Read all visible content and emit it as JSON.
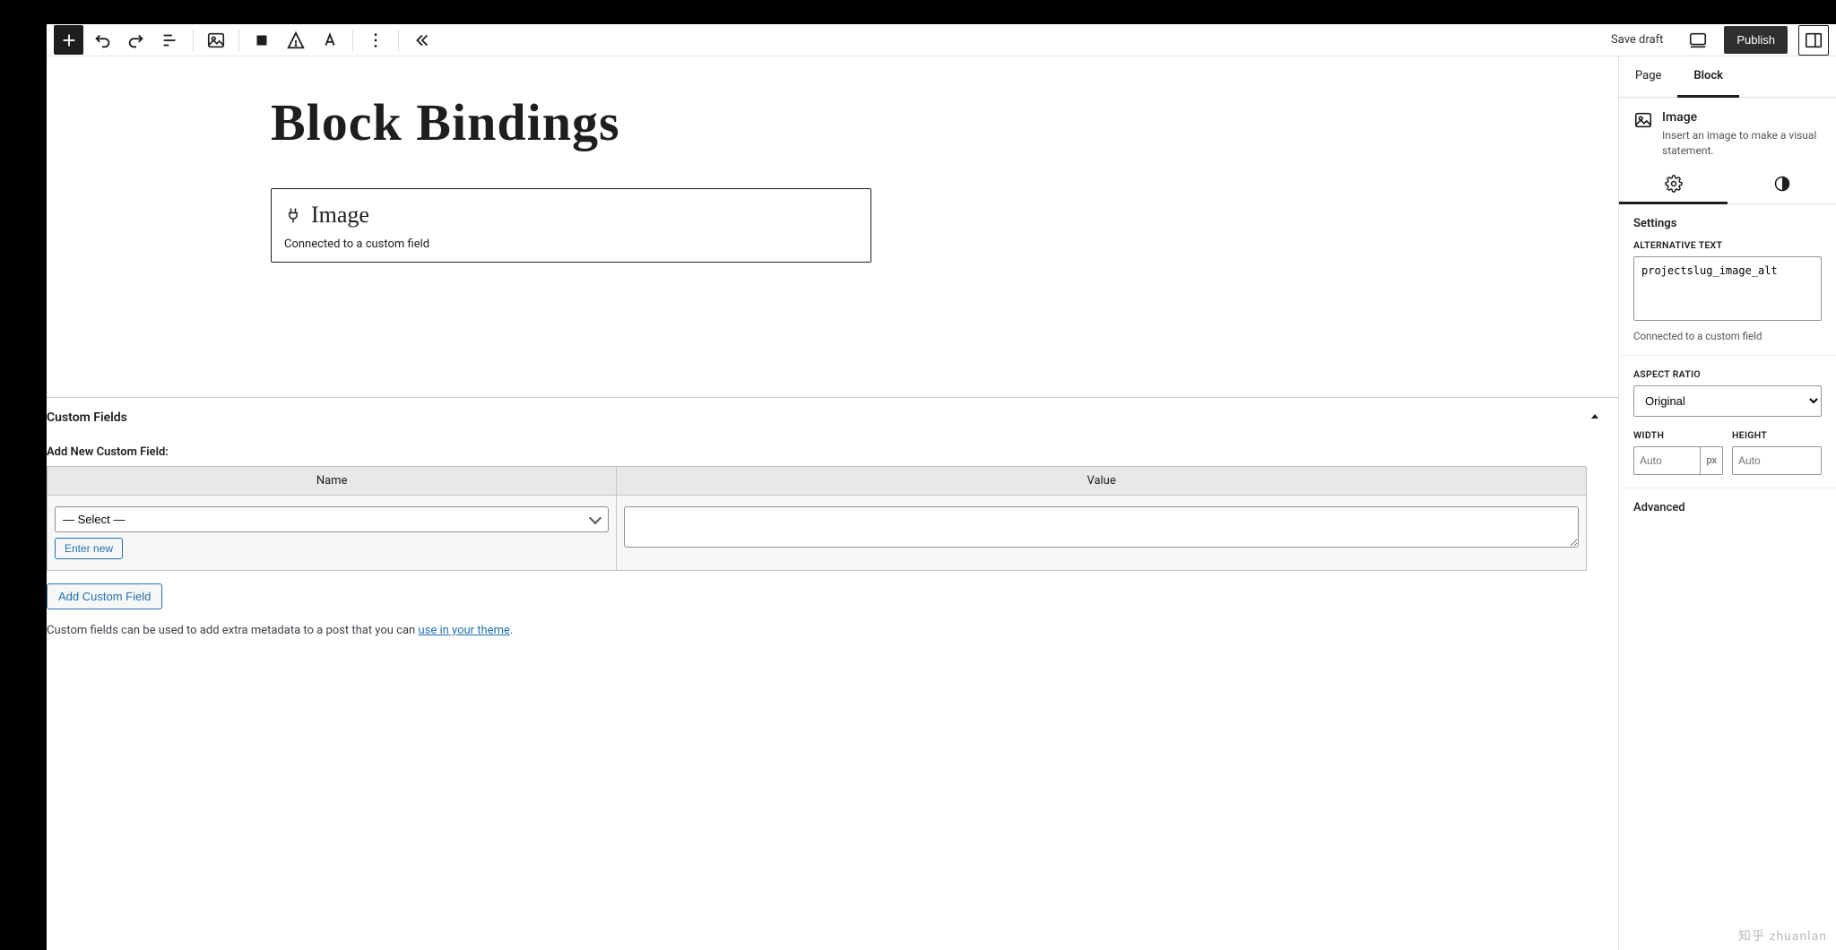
{
  "toolbar": {
    "save_draft": "Save draft",
    "publish": "Publish"
  },
  "page": {
    "title": "Block Bindings"
  },
  "image_block": {
    "label": "Image",
    "connected": "Connected to a custom field"
  },
  "custom_fields": {
    "panel_title": "Custom Fields",
    "add_new_label": "Add New Custom Field:",
    "col_name": "Name",
    "col_value": "Value",
    "select_placeholder": "— Select —",
    "enter_new": "Enter new",
    "add_button": "Add Custom Field",
    "help_prefix": "Custom fields can be used to add extra metadata to a post that you can ",
    "help_link": "use in your theme",
    "help_suffix": "."
  },
  "sidebar": {
    "tabs": {
      "page": "Page",
      "block": "Block"
    },
    "block": {
      "name": "Image",
      "desc": "Insert an image to make a visual statement."
    },
    "settings": {
      "heading": "Settings",
      "alt_label": "ALTERNATIVE TEXT",
      "alt_value": "projectslug_image_alt",
      "alt_hint": "Connected to a custom field",
      "aspect_label": "ASPECT RATIO",
      "aspect_value": "Original",
      "width_label": "WIDTH",
      "width_placeholder": "Auto",
      "width_unit": "px",
      "height_label": "HEIGHT",
      "height_placeholder": "Auto"
    },
    "advanced": "Advanced"
  },
  "watermark": "知乎 zhuanlan"
}
